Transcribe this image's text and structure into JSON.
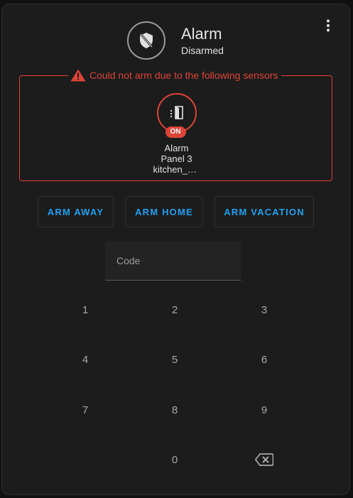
{
  "entity": {
    "name": "Alarm",
    "state": "Disarmed",
    "state_icon": "shield-off-icon"
  },
  "menu": {
    "icon": "dots-vertical-icon"
  },
  "warning": {
    "icon": "alert-triangle-icon",
    "text": "Could not arm due to the following sensors",
    "color": "#db4437"
  },
  "sensors": [
    {
      "icon": "door-open-icon",
      "state_badge": "ON",
      "name_line1": "Alarm",
      "name_line2": "Panel 3",
      "name_line3": "kitchen_door"
    }
  ],
  "actions": [
    {
      "label": "ARM AWAY"
    },
    {
      "label": "ARM HOME"
    },
    {
      "label": "ARM VACATION"
    }
  ],
  "code_input": {
    "placeholder": "Code",
    "value": ""
  },
  "keypad": {
    "keys": [
      "1",
      "2",
      "3",
      "4",
      "5",
      "6",
      "7",
      "8",
      "9",
      "0"
    ],
    "backspace_icon": "backspace-icon"
  },
  "colors": {
    "accent": "#1ea1f2",
    "error": "#db4437",
    "card_bg": "#1c1c1c"
  }
}
